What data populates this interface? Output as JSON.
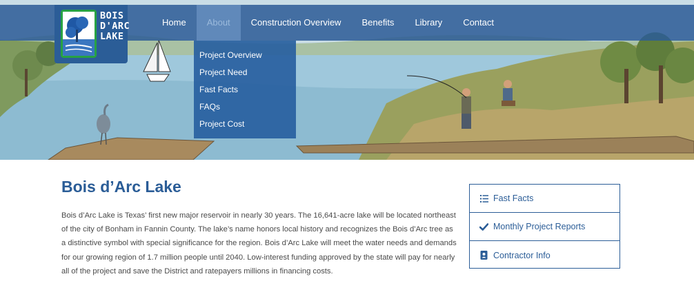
{
  "header": {
    "logo_lines": [
      "BOIS",
      "D'ARC",
      "LAKE"
    ],
    "nav": [
      {
        "label": "Home",
        "active": false
      },
      {
        "label": "About",
        "active": true
      },
      {
        "label": "Construction Overview",
        "active": false
      },
      {
        "label": "Benefits",
        "active": false
      },
      {
        "label": "Library",
        "active": false
      },
      {
        "label": "Contact",
        "active": false
      }
    ]
  },
  "dropdown": {
    "items": [
      "Project Overview",
      "Project Need",
      "Fast Facts",
      "FAQs",
      "Project Cost"
    ]
  },
  "main": {
    "title": "Bois d’Arc Lake",
    "body": "Bois d’Arc Lake is Texas’ first new major reservoir in nearly 30 years. The 16,641-acre lake will be located northeast of the city of Bonham in Fannin County. The lake’s name honors local history and recognizes the Bois d’Arc tree as a distinctive symbol with special significance for the region. Bois d’Arc Lake will meet the water needs and demands for our growing region of 1.7 million people until 2040. Low-interest funding approved by the state will pay for nearly all of the project and save the District and ratepayers millions in financing costs."
  },
  "sidebar": {
    "items": [
      {
        "label": "Fast Facts",
        "icon": "list-icon"
      },
      {
        "label": "Monthly Project Reports",
        "icon": "checkmark-icon"
      },
      {
        "label": "Contractor Info",
        "icon": "address-book-icon"
      }
    ]
  },
  "colors": {
    "brand_blue": "#2b5d97",
    "nav_bg": "#2c5c96",
    "dropdown_bg": "#2860a0",
    "logo_green": "#27a243",
    "water": "#9fc8dc",
    "body_text": "#4a4a4a"
  }
}
